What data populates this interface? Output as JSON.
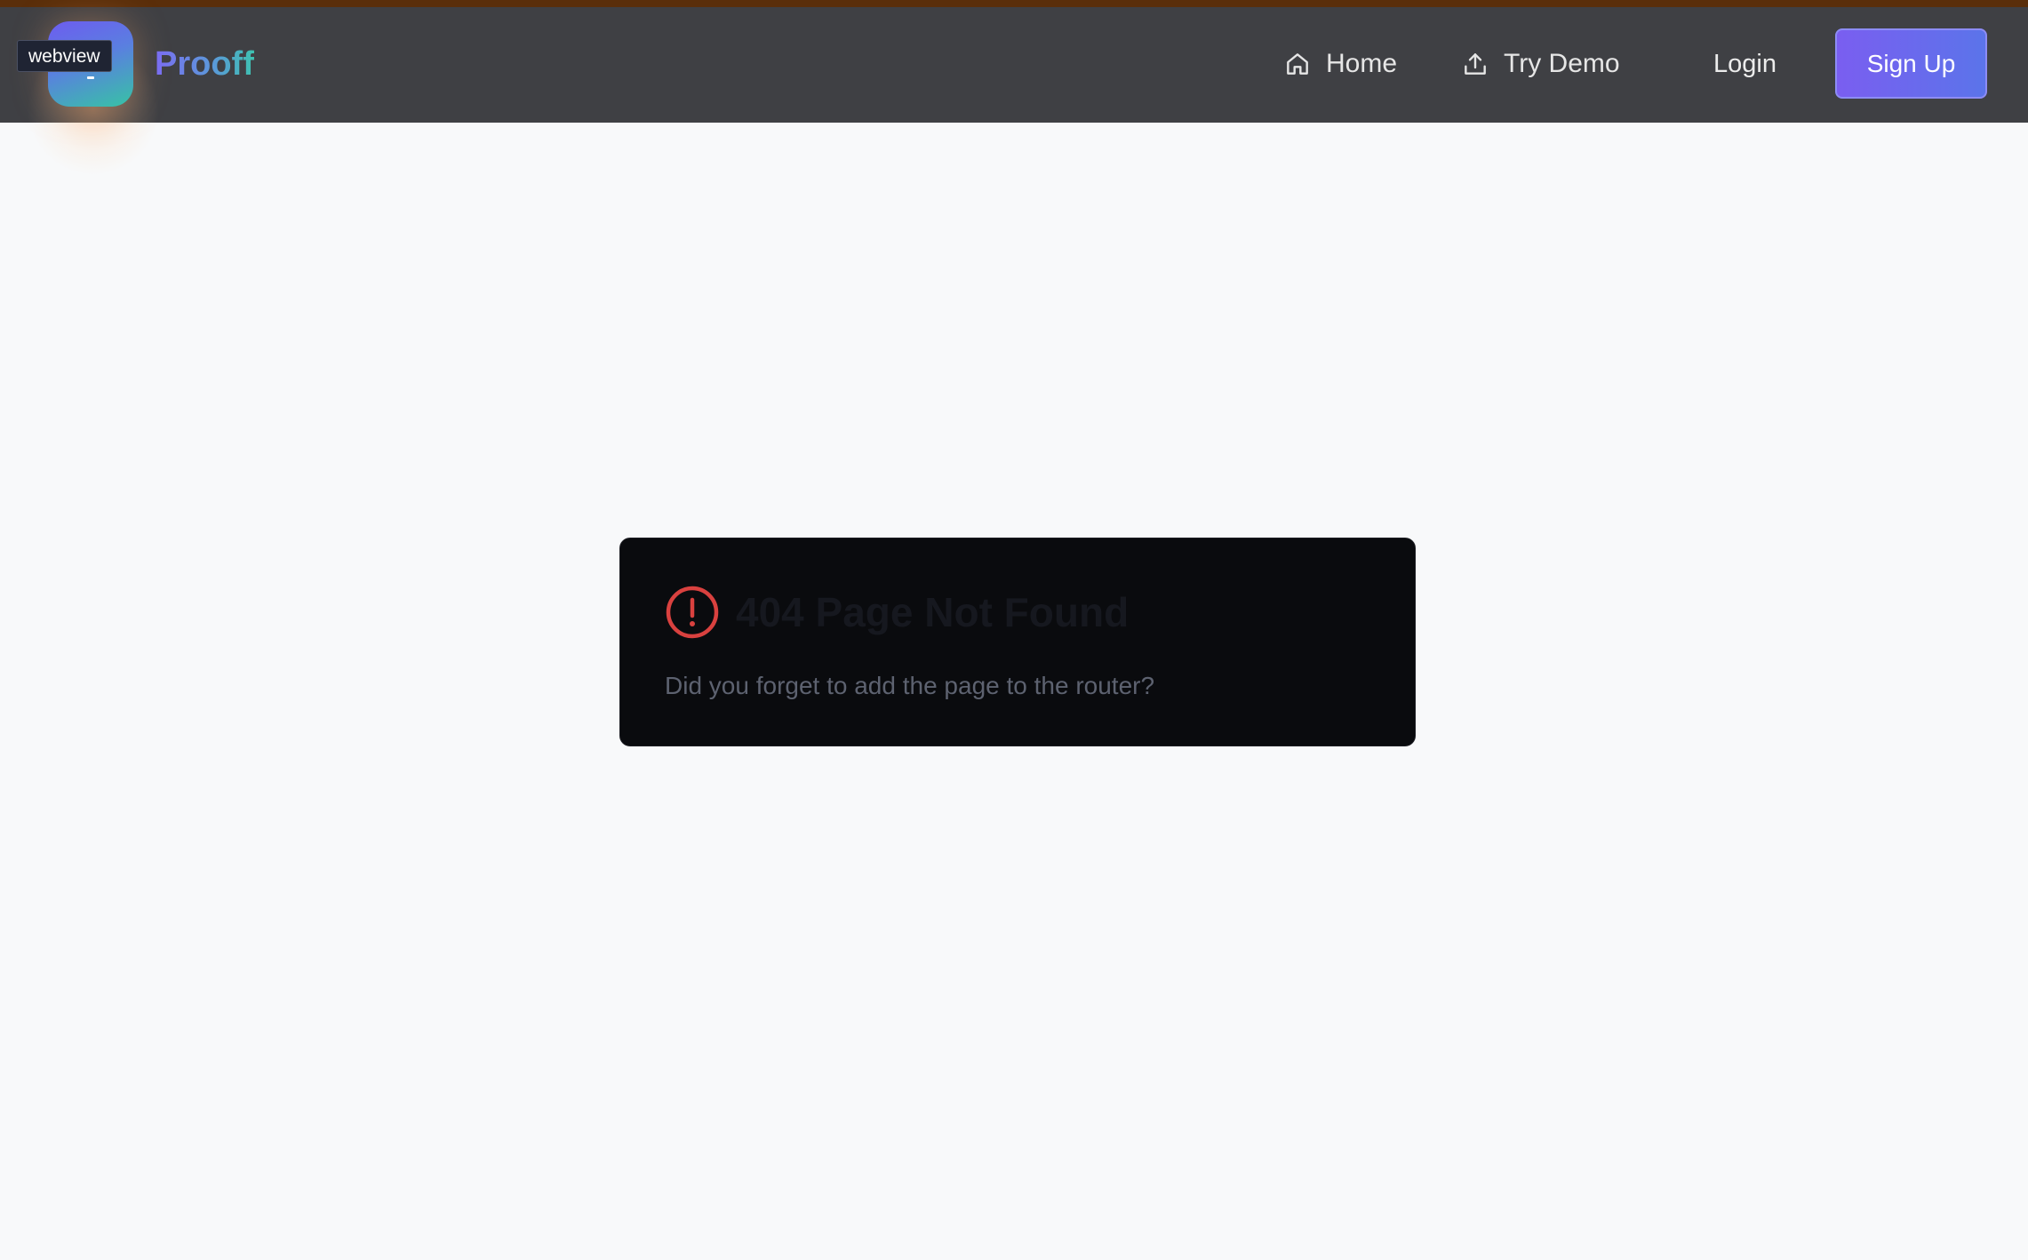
{
  "header": {
    "badge": "webview",
    "brand": "Prooff",
    "nav": {
      "home": {
        "label": "Home",
        "icon": "home-icon"
      },
      "demo": {
        "label": "Try Demo",
        "icon": "upload-icon"
      },
      "login": {
        "label": "Login"
      },
      "signup": {
        "label": "Sign Up"
      }
    }
  },
  "error_card": {
    "icon": "alert-circle-icon",
    "title": "404 Page Not Found",
    "description": "Did you forget to add the page to the router?"
  },
  "colors": {
    "navbar": "#3f4044",
    "accent_gradient_start": "#7a5ef0",
    "accent_gradient_end": "#5b74ea",
    "error_red": "#d9413f",
    "card_bg": "#0a0b0e",
    "page_bg": "#f8f9fa"
  }
}
